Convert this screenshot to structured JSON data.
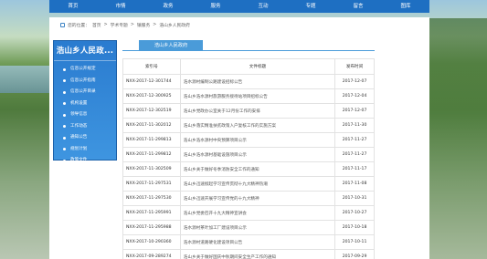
{
  "nav": {
    "items": [
      "首页",
      "市情",
      "政务",
      "服务",
      "互动",
      "专题",
      "留言",
      "图库"
    ]
  },
  "breadcrumb": {
    "prefix": "您的位置：",
    "items": [
      "首页",
      "学术专题",
      "镇服务",
      "浩山乡人民政府"
    ]
  },
  "sidebar": {
    "title": "浩山乡人民政...",
    "items": [
      "信息公开规定",
      "信息公开指南",
      "信息公开目录",
      "机构设置",
      "领导信息",
      "工作动态",
      "通知公告",
      "规划计划",
      "政策文件"
    ]
  },
  "content": {
    "tab_title": "浩山乡人民政府",
    "columns": [
      "索引号",
      "文件标题",
      "发布时间"
    ],
    "rows": [
      {
        "id": "NXX-2017-12-301744",
        "title": "浩水源村编制公路建设招标公告",
        "date": "2017-12-07"
      },
      {
        "id": "NXX-2017-12-300925",
        "title": "浩山乡浩水源村旅游服务接待站项目招标公告",
        "date": "2017-12-04"
      },
      {
        "id": "NXX-2017-12-302519",
        "title": "浩山乡党政办公室关于12月份工作的安排",
        "date": "2017-12-07"
      },
      {
        "id": "NXX-2017-11-302012",
        "title": "浩山乡落实精准扶贫政策入户复核工作的实施方案",
        "date": "2017-11-30"
      },
      {
        "id": "NXX-2017-11-299813",
        "title": "浩山乡浩水源村中央预算项目公示",
        "date": "2017-11-27"
      },
      {
        "id": "NXX-2017-11-299812",
        "title": "浩山乡浩水源村基础设施项目公示",
        "date": "2017-11-27"
      },
      {
        "id": "NXX-2017-11-302509",
        "title": "浩山乡关于做好冬季消防安全工作的通知",
        "date": "2017-11-17"
      },
      {
        "id": "NXX-2017-11-297531",
        "title": "浩山乡迅速掀起学习宣传贯彻十九大精神热潮",
        "date": "2017-11-08"
      },
      {
        "id": "NXX-2017-11-297530",
        "title": "浩山乡迅速开展学习宣传党的十九大精神",
        "date": "2017-10-31"
      },
      {
        "id": "NXX-2017-11-295991",
        "title": "浩山乡党委召开十九大精神宣讲会",
        "date": "2017-10-27"
      },
      {
        "id": "NXX-2017-11-295988",
        "title": "浩水源村茶叶加工厂建设项目公示",
        "date": "2017-10-18"
      },
      {
        "id": "NXX-2017-10-290360",
        "title": "浩水源村道路硬化建设项目公告",
        "date": "2017-10-11"
      },
      {
        "id": "NXX-2017-09-289274",
        "title": "浩山乡关于做好国庆中秋期间安全生产工作的通知",
        "date": "2017-09-29"
      }
    ]
  }
}
